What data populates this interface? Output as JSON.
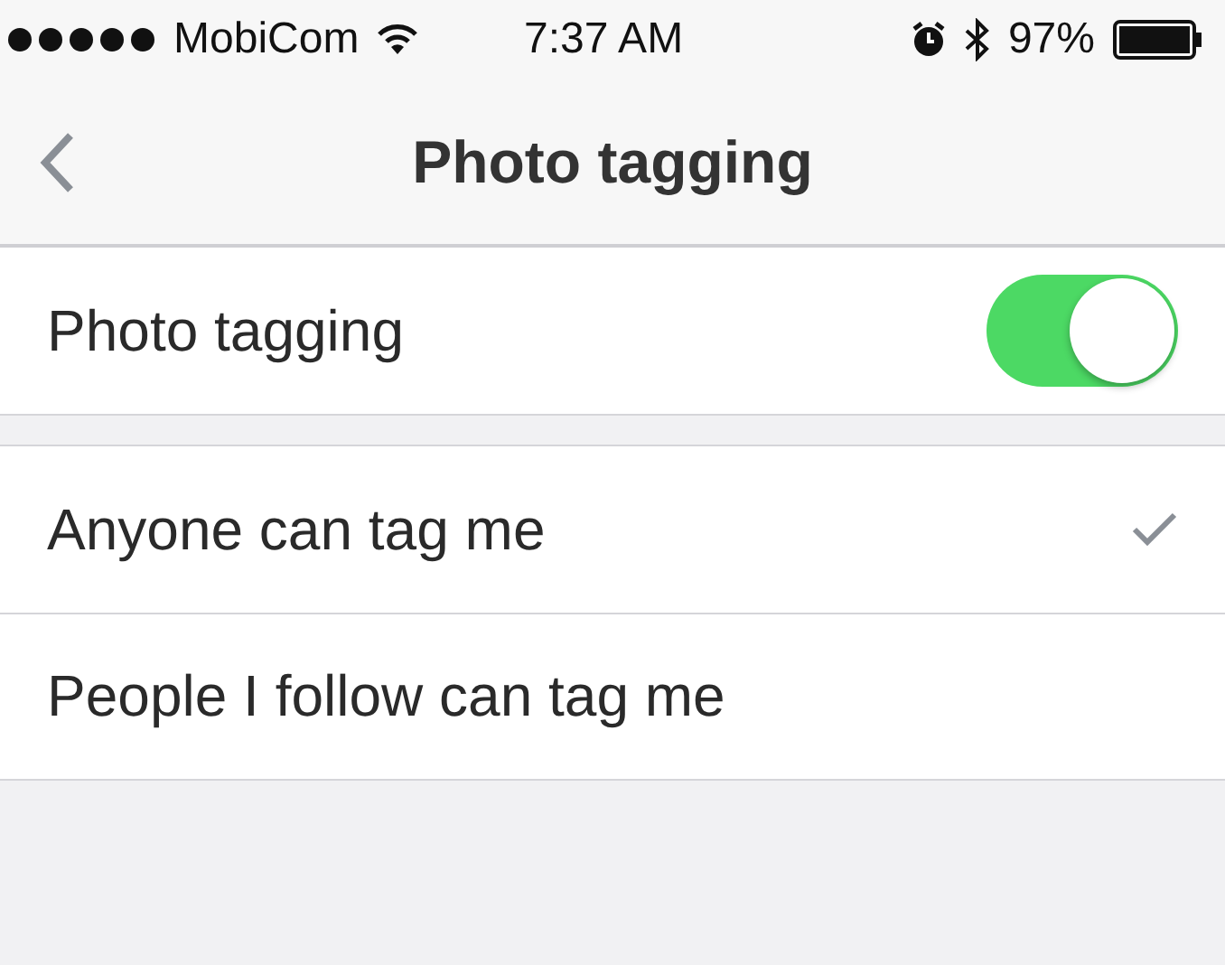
{
  "status_bar": {
    "carrier": "MobiCom",
    "time": "7:37 AM",
    "battery": "97%"
  },
  "nav_bar": {
    "title": "Photo tagging"
  },
  "toggle_row": {
    "label": "Photo tagging",
    "on": true
  },
  "options": [
    {
      "label": "Anyone can tag me",
      "selected": true
    },
    {
      "label": "People I follow can tag me",
      "selected": false
    }
  ]
}
